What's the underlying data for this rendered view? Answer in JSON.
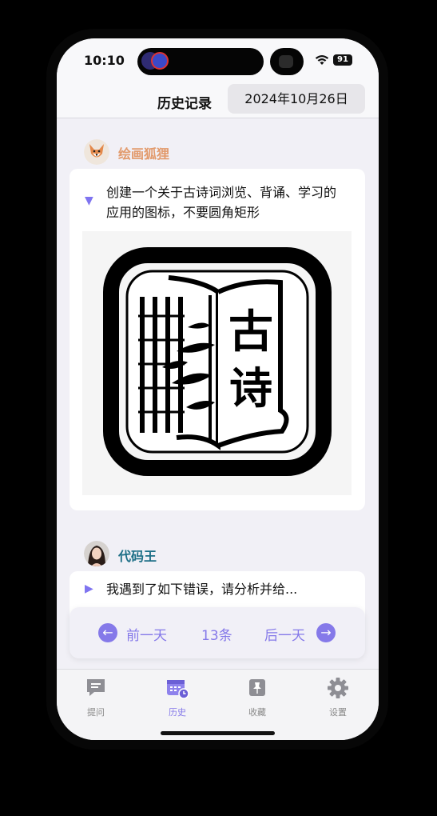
{
  "status_bar": {
    "time": "10:10",
    "battery": "91"
  },
  "header": {
    "title": "历史记录",
    "date": "2024年10月26日"
  },
  "messages": [
    {
      "author": "绘画狐狸",
      "author_color": "#e29a6c",
      "prompt": "创建一个关于古诗词浏览、背诵、学习的应用的图标，不要圆角矩形",
      "expanded": true,
      "image_glyphs": [
        "古",
        "诗"
      ]
    },
    {
      "author": "代码王",
      "author_color": "#1d6f86",
      "prompt": "我遇到了如下错误，请分析并给...",
      "expanded": false
    }
  ],
  "pager": {
    "prev_label": "前一天",
    "count_label": "13条",
    "next_label": "后一天",
    "accent": "#8579e9"
  },
  "tabs": [
    {
      "label": "提问",
      "icon": "chat-icon"
    },
    {
      "label": "历史",
      "icon": "calendar-clock-icon",
      "active": true
    },
    {
      "label": "收藏",
      "icon": "pin-icon"
    },
    {
      "label": "设置",
      "icon": "gear-icon"
    }
  ]
}
